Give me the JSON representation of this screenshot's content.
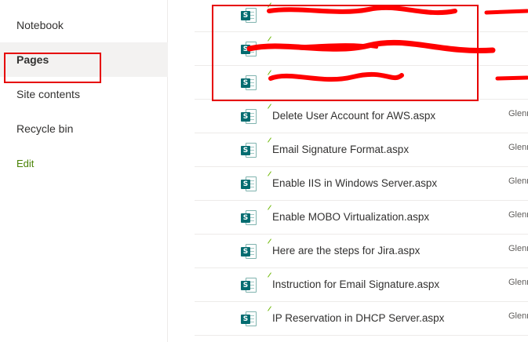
{
  "nav": {
    "items": [
      {
        "label": "Notebook",
        "selected": false
      },
      {
        "label": "Pages",
        "selected": true
      },
      {
        "label": "Site contents",
        "selected": false
      },
      {
        "label": "Recycle bin",
        "selected": false
      }
    ],
    "edit_label": "Edit"
  },
  "file_icon": {
    "badge": "S",
    "icon_name": "sharepoint-page-icon"
  },
  "files": [
    {
      "name": "",
      "modified_by": "",
      "redacted": true
    },
    {
      "name": "",
      "modified_by": "",
      "redacted": true
    },
    {
      "name": "",
      "modified_by": "",
      "redacted": true
    },
    {
      "name": "Delete User Account for AWS.aspx",
      "modified_by": "Glenn"
    },
    {
      "name": "Email Signature Format.aspx",
      "modified_by": "Glenn"
    },
    {
      "name": "Enable IIS in Windows Server.aspx",
      "modified_by": "Glenn"
    },
    {
      "name": "Enable MOBO Virtualization.aspx",
      "modified_by": "Glenn"
    },
    {
      "name": "Here are the steps for Jira.aspx",
      "modified_by": "Glenn"
    },
    {
      "name": "Instruction for Email Signature.aspx",
      "modified_by": "Glenn"
    },
    {
      "name": "IP Reservation in DHCP Server.aspx",
      "modified_by": "Glenn"
    }
  ],
  "colors": {
    "annotation_red": "#e60000",
    "redaction_red": "#ff0000",
    "sharepoint_teal": "#036c70",
    "new_mark_green": "#6bb700",
    "edit_green": "#498205"
  }
}
